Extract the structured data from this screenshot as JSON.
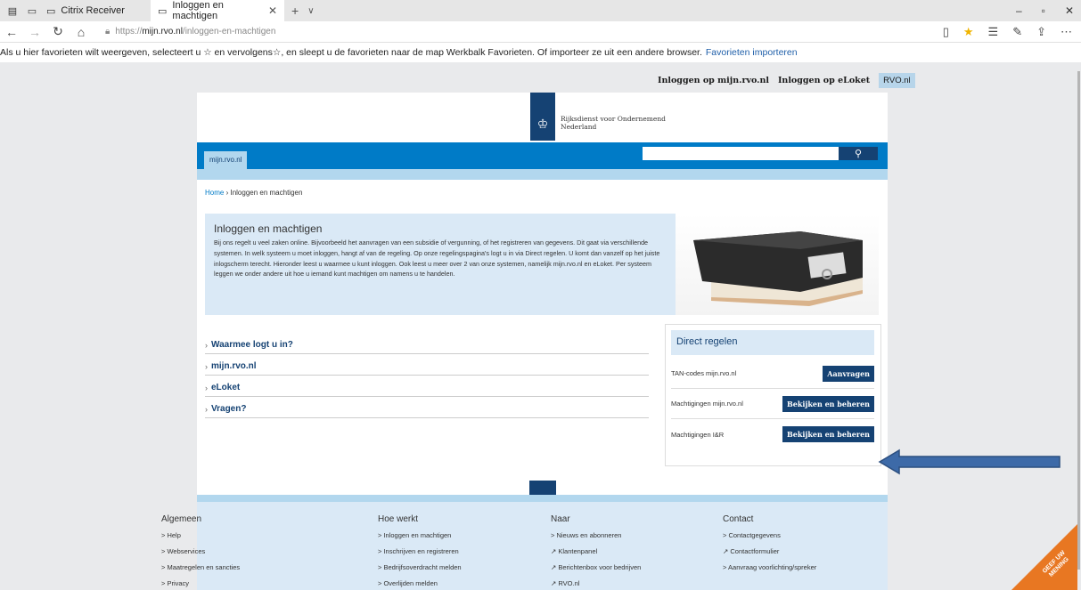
{
  "tabs": [
    {
      "label": "Citrix Receiver",
      "active": false
    },
    {
      "label": "Inloggen en machtigen",
      "active": true
    }
  ],
  "address": {
    "scheme": "https://",
    "host": "mijn.rvo.nl",
    "path": "/inloggen-en-machtigen"
  },
  "favbar": {
    "text": "Als u hier favorieten wilt weergeven, selecteert u ☆ en vervolgens☆, en sleept u de favorieten naar de map Werkbalk Favorieten. Of importeer ze uit een andere browser.",
    "link": "Favorieten importeren"
  },
  "toplinks": {
    "mijn": "Inloggen op mijn.rvo.nl",
    "eloket": "Inloggen op eLoket",
    "rvo": "RVO.nl"
  },
  "logo": {
    "line1": "Rijksdienst voor Ondernemend",
    "line2": "Nederland"
  },
  "nav": {
    "tab": "mijn.rvo.nl"
  },
  "breadcrumb": {
    "home": "Home",
    "current": "Inloggen en machtigen"
  },
  "intro": {
    "title": "Inloggen en machtigen",
    "body": "Bij ons regelt u veel zaken online. Bijvoorbeeld het aanvragen van een subsidie of vergunning, of het registreren van gegevens. Dit gaat via verschillende systemen. In welk systeem u moet inloggen, hangt af van de regeling. Op onze regelingspagina's logt u in via Direct regelen. U komt dan vanzelf op het juiste inlogscherm terecht. Hieronder leest u waarmee u kunt inloggen. Ook leest u meer over 2 van onze systemen, namelijk mijn.rvo.nl en eLoket. Per systeem leggen we onder andere uit hoe u iemand kunt machtigen om namens u te handelen."
  },
  "accordion": [
    "Waarmee logt u in?",
    "mijn.rvo.nl",
    "eLoket",
    "Vragen?"
  ],
  "direct_regelen": {
    "title": "Direct regelen",
    "rows": [
      {
        "label": "TAN-codes mijn.rvo.nl",
        "button": "Aanvragen"
      },
      {
        "label": "Machtigingen mijn.rvo.nl",
        "button": "Bekijken en beheren"
      },
      {
        "label": "Machtigingen I&R",
        "button": "Bekijken en beheren"
      }
    ]
  },
  "footer": [
    {
      "title": "Algemeen",
      "items": [
        "> Help",
        "> Webservices",
        "> Maatregelen en sancties",
        "> Privacy"
      ]
    },
    {
      "title": "Hoe werkt",
      "items": [
        "> Inloggen en machtigen",
        "> Inschrijven en registreren",
        "> Bedrijfsoverdracht melden",
        "> Overlijden melden"
      ]
    },
    {
      "title": "Naar",
      "items": [
        "> Nieuws en abonneren",
        "↗ Klantenpanel",
        "↗ Berichtenbox voor bedrijven",
        "↗ RVO.nl"
      ]
    },
    {
      "title": "Contact",
      "items": [
        "> Contactgegevens",
        "↗ Contactformulier",
        "> Aanvraag voorlichting/spreker"
      ]
    }
  ],
  "feedback": {
    "line1": "GEEF UW",
    "line2": "MENING"
  },
  "colors": {
    "brand_dark": "#154273",
    "brand_blue": "#007bc7",
    "light_blue": "#dae9f6",
    "arrow": "#3d6aa8",
    "feedback": "#e87722"
  }
}
